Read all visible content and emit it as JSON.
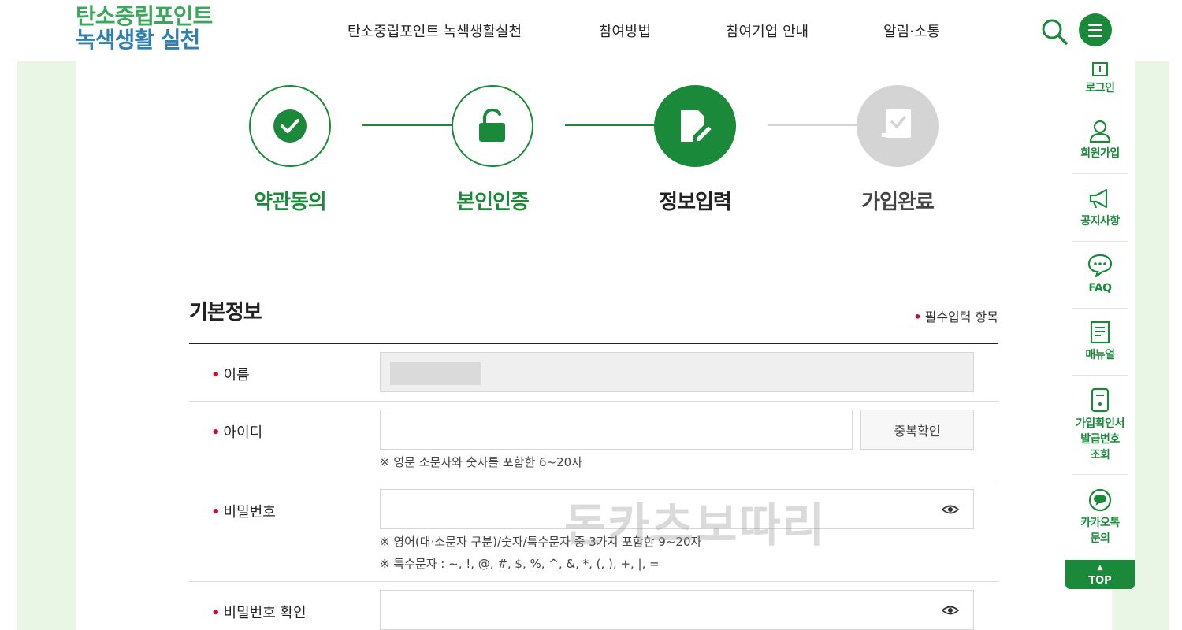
{
  "header": {
    "logo_line1": "탄소중립포인트",
    "logo_line2": "녹색생활 실천",
    "nav": [
      "탄소중립포인트 녹색생활실천",
      "참여방법",
      "참여기업 안내",
      "알림·소통"
    ]
  },
  "steps": [
    {
      "label": "약관동의",
      "state": "done",
      "icon": "check-icon"
    },
    {
      "label": "본인인증",
      "state": "done",
      "icon": "unlock-icon"
    },
    {
      "label": "정보입력",
      "state": "current",
      "icon": "edit-document-icon"
    },
    {
      "label": "가입완료",
      "state": "pending",
      "icon": "document-check-icon"
    }
  ],
  "form": {
    "section_title": "기본정보",
    "required_note": "필수입력 항목",
    "required_mark": "•",
    "name_label": "이름",
    "id_label": "아이디",
    "id_check_button": "중복확인",
    "id_hint": "※ 영문 소문자와 숫자를 포함한 6~20자",
    "password_label": "비밀번호",
    "password_hint1": "※ 영어(대·소문자 구분)/숫자/특수문자 중 3가지 포함한 9~20자",
    "password_hint2": "※ 특수문자 : ~, !, @, #, $, %, ^, &, *, (, ), +, |, =",
    "password_confirm_label": "비밀번호 확인"
  },
  "watermark": "돈카츠보따리",
  "quick_menu": {
    "items": [
      "로그인",
      "회원가입",
      "공지사항",
      "FAQ",
      "매뉴얼",
      "가입확인서\n발급번호\n조회",
      "카카오톡\n문의"
    ],
    "top": "TOP"
  },
  "colors": {
    "brand_green": "#1a8a3a",
    "logo_green": "#3aa85a",
    "logo_blue": "#2f7fb0",
    "pending_gray": "#d4d4d4",
    "required_red": "#c8102e",
    "band_green": "#e9f6e5"
  }
}
